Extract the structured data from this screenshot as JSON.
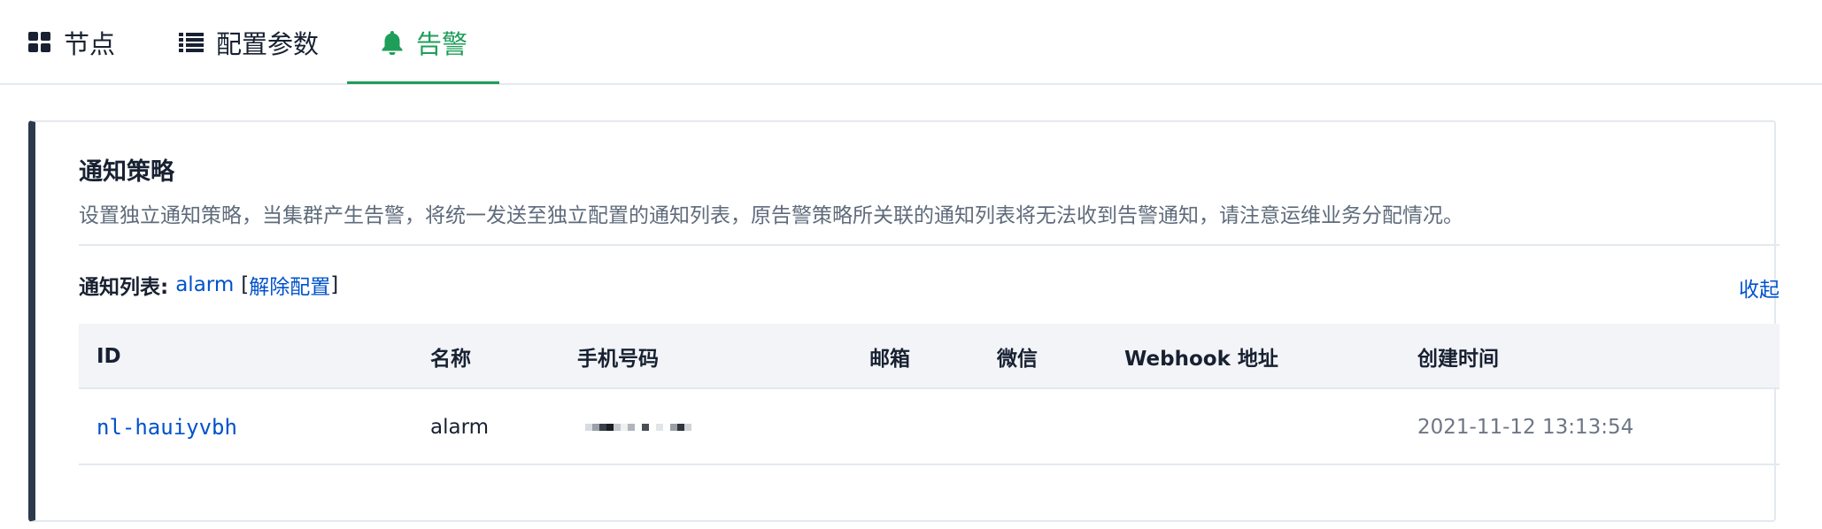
{
  "tabs": [
    {
      "label": "节点",
      "icon": "grid-icon",
      "active": false
    },
    {
      "label": "配置参数",
      "icon": "list-icon",
      "active": false
    },
    {
      "label": "告警",
      "icon": "bell-icon",
      "active": true
    }
  ],
  "colors": {
    "accent": "#1f9e5a",
    "link": "#0052cc",
    "card_border_left": "#2c3a4c"
  },
  "policy": {
    "title": "通知策略",
    "description": "设置独立通知策略，当集群产生告警，将统一发送至独立配置的通知列表，原告警策略所关联的通知列表将无法收到告警通知，请注意运维业务分配情况。",
    "list_label": "通知列表:",
    "list_name": "alarm",
    "bracket_open": "[",
    "unbind_label": "解除配置",
    "bracket_close": "]",
    "collapse_label": "收起"
  },
  "table": {
    "headers": {
      "id": "ID",
      "name": "名称",
      "phone": "手机号码",
      "email": "邮箱",
      "wechat": "微信",
      "webhook": "Webhook 地址",
      "created": "创建时间"
    },
    "rows": [
      {
        "id": "nl-hauiyvbh",
        "name": "alarm",
        "phone": "[redacted]",
        "email": "",
        "wechat": "",
        "webhook": "",
        "created": "2021-11-12 13:13:54"
      }
    ]
  }
}
